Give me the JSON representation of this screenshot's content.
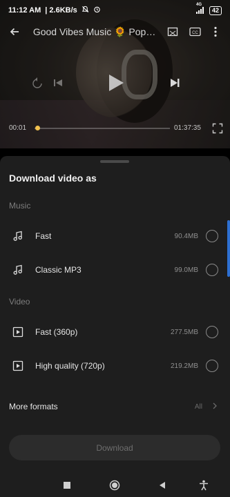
{
  "status_bar": {
    "time": "11:12 AM",
    "speed": "| 2.6KB/s",
    "network": "4G",
    "battery": "42"
  },
  "player": {
    "title": "Good Vibes Music 🌻 Popul...",
    "current_time": "00:01",
    "total_time": "01:37:35",
    "progress": 0.003
  },
  "sheet": {
    "title": "Download video as",
    "music_label": "Music",
    "video_label": "Video",
    "options": [
      {
        "label": "Fast",
        "size": "90.4MB",
        "icon": "music-note-icon"
      },
      {
        "label": "Classic MP3",
        "size": "99.0MB",
        "icon": "music-note-icon"
      },
      {
        "label": "Fast (360p)",
        "size": "277.5MB",
        "icon": "play-box-icon"
      },
      {
        "label": "High quality (720p)",
        "size": "219.2MB",
        "icon": "play-box-icon"
      }
    ],
    "more_formats": "More formats",
    "more_all": "All",
    "download": "Download"
  },
  "colors": {
    "sheet_bg": "#1e1e1e",
    "accent": "#2d6fd1",
    "seek_thumb": "#f2c14e"
  }
}
